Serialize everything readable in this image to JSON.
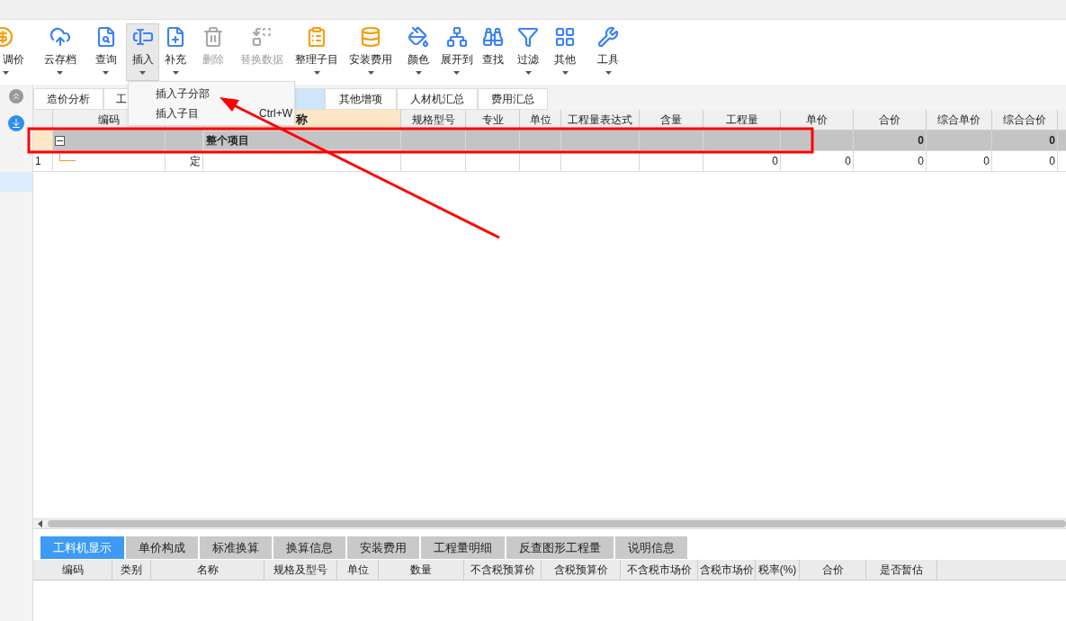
{
  "toolbar": [
    {
      "label": "调价",
      "disabled": false,
      "selected": false,
      "has_menu": true
    },
    {
      "label": "云存档",
      "disabled": false,
      "selected": false,
      "has_menu": true
    },
    {
      "label": "查询",
      "disabled": false,
      "selected": false,
      "has_menu": true
    },
    {
      "label": "插入",
      "disabled": false,
      "selected": true,
      "has_menu": true
    },
    {
      "label": "补充",
      "disabled": false,
      "selected": false,
      "has_menu": true
    },
    {
      "label": "删除",
      "disabled": true,
      "selected": false,
      "has_menu": false
    },
    {
      "label": "替换数据",
      "disabled": true,
      "selected": false,
      "has_menu": false
    },
    {
      "label": "整理子目",
      "disabled": false,
      "selected": false,
      "has_menu": true
    },
    {
      "label": "安装费用",
      "disabled": false,
      "selected": false,
      "has_menu": true
    },
    {
      "label": "颜色",
      "disabled": false,
      "selected": false,
      "has_menu": true
    },
    {
      "label": "展开到",
      "disabled": false,
      "selected": false,
      "has_menu": true
    },
    {
      "label": "查找",
      "disabled": false,
      "selected": false,
      "has_menu": false
    },
    {
      "label": "过滤",
      "disabled": false,
      "selected": false,
      "has_menu": true
    },
    {
      "label": "其他",
      "disabled": false,
      "selected": false,
      "has_menu": true
    },
    {
      "label": "工具",
      "disabled": false,
      "selected": false,
      "has_menu": true
    }
  ],
  "dropdown_menu": [
    {
      "label": "插入子分部"
    },
    {
      "label": "插入子目",
      "shortcut": "Ctrl+W"
    }
  ],
  "tabs": [
    {
      "label": "造价分析",
      "selected": false
    },
    {
      "label": "工",
      "selected": false
    },
    {
      "selected": true
    },
    {
      "label": "其他增项",
      "selected": false
    },
    {
      "label": "人材机汇总",
      "selected": false
    },
    {
      "label": "费用汇总",
      "selected": false
    }
  ],
  "table": {
    "columns": [
      "",
      "编码",
      "",
      "称",
      "规格型号",
      "专业",
      "单位",
      "工程量表达式",
      "含量",
      "工程量",
      "单价",
      "合价",
      "综合单价",
      "综合合价"
    ],
    "rows": [
      {
        "kind": "section",
        "expanded": true,
        "cells": [
          "",
          "",
          "",
          "整个项目",
          "",
          "",
          "",
          "",
          "",
          "",
          "",
          "0",
          "",
          "0"
        ]
      },
      {
        "kind": "item",
        "cells": [
          "1",
          "",
          "定",
          "",
          "",
          "",
          "",
          "",
          "",
          "0",
          "0",
          "0",
          "0",
          "0"
        ]
      }
    ]
  },
  "bottom_tabs": [
    {
      "label": "工料机显示",
      "selected": true
    },
    {
      "label": "单价构成",
      "selected": false
    },
    {
      "label": "标准换算",
      "selected": false
    },
    {
      "label": "换算信息",
      "selected": false
    },
    {
      "label": "安装费用",
      "selected": false
    },
    {
      "label": "工程量明细",
      "selected": false
    },
    {
      "label": "反查图形工程量",
      "selected": false
    },
    {
      "label": "说明信息",
      "selected": false
    }
  ],
  "bottom_table": {
    "columns": [
      "编码",
      "类别",
      "名称",
      "规格及型号",
      "单位",
      "数量",
      "不含税预算价",
      "含税预算价",
      "不含税市场价",
      "含税市场价",
      "税率(%)",
      "合价",
      "是否暂估"
    ]
  }
}
